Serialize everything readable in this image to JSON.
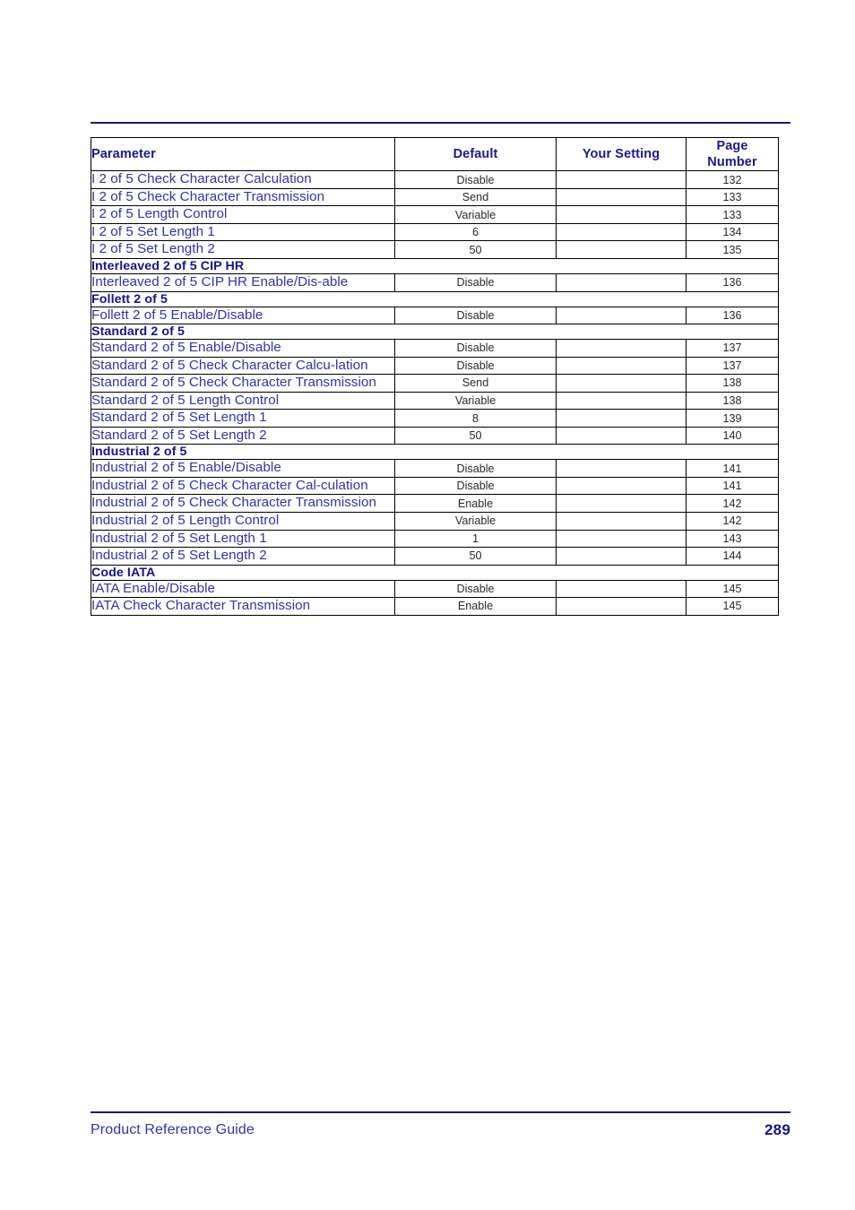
{
  "document": {
    "type": "reference-guide-page",
    "footer": {
      "left_label": "Product Reference Guide",
      "page_number": "289"
    }
  },
  "colors": {
    "header_text": "#1a1a8c",
    "parameter_text": "#3333a8",
    "section_text": "#14148c",
    "value_text": "#2a2a2a",
    "rule": "#1b1b6f",
    "border": "#000000"
  },
  "table": {
    "columns": [
      {
        "key": "parameter",
        "label": "Parameter",
        "align": "left"
      },
      {
        "key": "default",
        "label": "Default",
        "align": "center"
      },
      {
        "key": "your_setting",
        "label": "Your Setting",
        "align": "center"
      },
      {
        "key": "page_number",
        "label": "Page\nNumber",
        "label_line1": "Page",
        "label_line2": "Number",
        "align": "center"
      }
    ],
    "rows": [
      {
        "kind": "data",
        "parameter": "I 2 of 5 Check Character Calculation",
        "default": "Disable",
        "your_setting": "",
        "page_number": "132"
      },
      {
        "kind": "data",
        "parameter": "I 2 of 5 Check Character Transmission",
        "default": "Send",
        "your_setting": "",
        "page_number": "133"
      },
      {
        "kind": "data",
        "parameter": "I 2 of 5 Length Control",
        "default": "Variable",
        "your_setting": "",
        "page_number": "133"
      },
      {
        "kind": "data",
        "parameter": "I 2 of 5 Set Length 1",
        "default": "6",
        "your_setting": "",
        "page_number": "134"
      },
      {
        "kind": "data",
        "parameter": "I 2 of 5 Set Length 2",
        "default": "50",
        "your_setting": "",
        "page_number": "135"
      },
      {
        "kind": "section",
        "parameter": "Interleaved 2 of 5 CIP HR"
      },
      {
        "kind": "data",
        "parameter": "Interleaved 2 of 5 CIP HR Enable/Dis-able",
        "default": "Disable",
        "your_setting": "",
        "page_number": "136"
      },
      {
        "kind": "section",
        "parameter": "Follett 2 of 5"
      },
      {
        "kind": "data",
        "parameter": "Follett 2 of 5 Enable/Disable",
        "default": "Disable",
        "your_setting": "",
        "page_number": "136"
      },
      {
        "kind": "section",
        "parameter": "Standard 2 of 5"
      },
      {
        "kind": "data",
        "parameter": "Standard 2 of 5 Enable/Disable",
        "default": "Disable",
        "your_setting": "",
        "page_number": "137"
      },
      {
        "kind": "data",
        "parameter": "Standard 2 of 5 Check Character Calcu-lation",
        "default": "Disable",
        "your_setting": "",
        "page_number": "137"
      },
      {
        "kind": "data",
        "parameter": "Standard 2 of 5 Check Character Transmission",
        "default": "Send",
        "your_setting": "",
        "page_number": "138"
      },
      {
        "kind": "data",
        "parameter": "Standard 2 of 5 Length Control",
        "default": "Variable",
        "your_setting": "",
        "page_number": "138"
      },
      {
        "kind": "data",
        "parameter": "Standard 2 of 5 Set Length 1",
        "default": "8",
        "your_setting": "",
        "page_number": "139"
      },
      {
        "kind": "data",
        "parameter": "Standard 2 of 5 Set Length 2",
        "default": "50",
        "your_setting": "",
        "page_number": "140"
      },
      {
        "kind": "section",
        "parameter": "Industrial 2 of 5"
      },
      {
        "kind": "data",
        "parameter": "Industrial 2 of 5 Enable/Disable",
        "default": "Disable",
        "your_setting": "",
        "page_number": "141"
      },
      {
        "kind": "data",
        "parameter": "Industrial 2 of 5 Check Character Cal-culation",
        "default": "Disable",
        "your_setting": "",
        "page_number": "141"
      },
      {
        "kind": "data",
        "parameter": "Industrial 2 of 5 Check Character Transmission",
        "default": "Enable",
        "your_setting": "",
        "page_number": "142"
      },
      {
        "kind": "data",
        "parameter": "Industrial 2 of 5 Length Control",
        "default": "Variable",
        "your_setting": "",
        "page_number": "142"
      },
      {
        "kind": "data",
        "parameter": "Industrial 2 of 5 Set Length 1",
        "default": "1",
        "your_setting": "",
        "page_number": "143"
      },
      {
        "kind": "data",
        "parameter": "Industrial 2 of 5 Set Length 2",
        "default": "50",
        "your_setting": "",
        "page_number": "144"
      },
      {
        "kind": "section",
        "parameter": "Code IATA"
      },
      {
        "kind": "data",
        "parameter": "IATA Enable/Disable",
        "default": "Disable",
        "your_setting": "",
        "page_number": "145"
      },
      {
        "kind": "data",
        "parameter": "IATA Check Character Transmission",
        "default": "Enable",
        "your_setting": "",
        "page_number": "145"
      }
    ]
  }
}
